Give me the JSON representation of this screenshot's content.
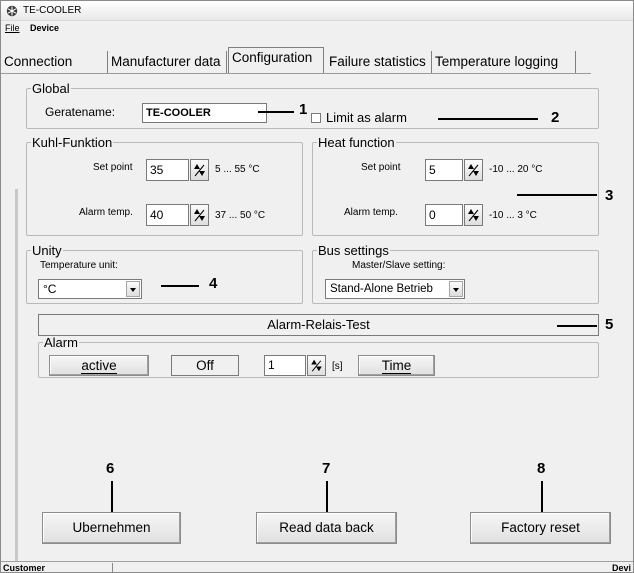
{
  "window": {
    "title": "TE-COOLER",
    "icon": "snowflake-icon"
  },
  "menu": {
    "items": [
      "File",
      "Device"
    ]
  },
  "tabs": {
    "items": [
      "Connection",
      "Manufacturer data",
      "Configuration",
      "Failure statistics",
      "Temperature logging"
    ],
    "active": "Configuration"
  },
  "global": {
    "legend": "Global",
    "device_name_label": "Geratename:",
    "device_name_value": "TE-COOLER",
    "limit_as_alarm_label": "Limit as alarm",
    "limit_as_alarm_checked": false
  },
  "cooling": {
    "legend": "Kuhl-Funktion",
    "setpoint_label": "Set point",
    "setpoint_value": "35",
    "setpoint_range": "5 ... 55 °C",
    "alarm_label": "Alarm temp.",
    "alarm_value": "40",
    "alarm_range": "37 ... 50 °C"
  },
  "heating": {
    "legend": "Heat function",
    "setpoint_label": "Set point",
    "setpoint_value": "5",
    "setpoint_range": "-10 ... 20 °C",
    "alarm_label": "Alarm temp.",
    "alarm_value": "0",
    "alarm_range": "-10 ... 3 °C"
  },
  "unity": {
    "legend": "Unity",
    "unit_label": "Temperature unit:",
    "unit_value": "°C"
  },
  "bus": {
    "legend": "Bus settings",
    "mode_label": "Master/Slave setting:",
    "mode_value": "Stand-Alone Betrieb"
  },
  "relay_test": {
    "label": "Alarm-Relais-Test"
  },
  "alarm": {
    "legend": "Alarm",
    "active_label": "active",
    "state_value": "Off",
    "duration_value": "1",
    "duration_unit": "[s]",
    "time_label": "Time"
  },
  "buttons": {
    "apply": "Ubernehmen",
    "read_back": "Read data back",
    "factory_reset": "Factory reset"
  },
  "callouts": [
    "1",
    "2",
    "3",
    "4",
    "5",
    "6",
    "7",
    "8"
  ],
  "status": {
    "left": "Customer",
    "right": "Devi"
  }
}
